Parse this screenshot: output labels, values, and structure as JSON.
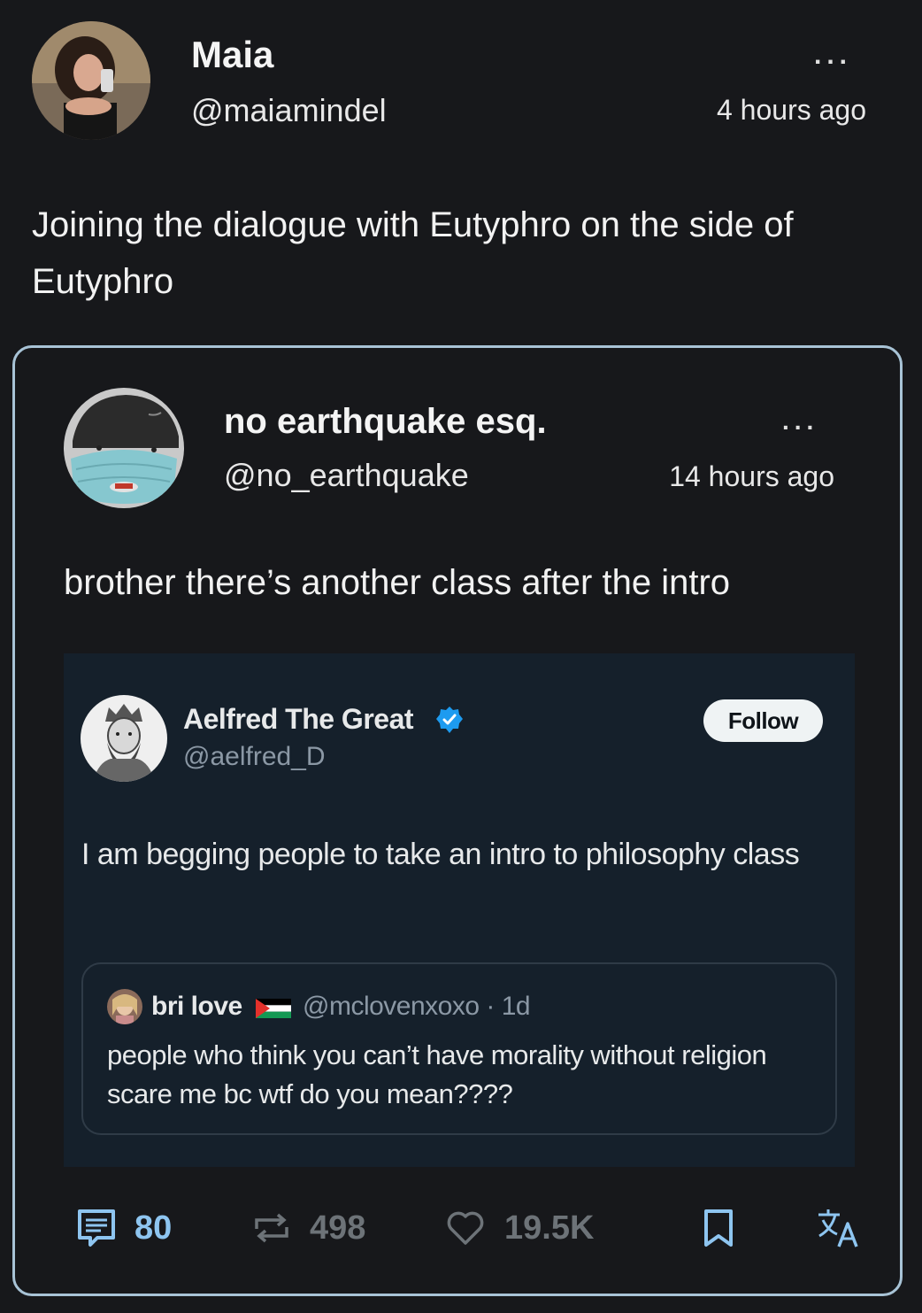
{
  "post": {
    "author_name": "Maia",
    "author_handle": "@maiamindel",
    "timestamp": "4 hours ago",
    "more_label": "...",
    "text": "Joining the dialogue with Eutyphro on the side of Eutyphro"
  },
  "quoted_post": {
    "author_name": "no earthquake esq.",
    "author_handle": "@no_earthquake",
    "timestamp": "14 hours ago",
    "more_label": "...",
    "text": "brother there’s another class after the intro",
    "embedded_tweet": {
      "author_name": "Aelfred The Great",
      "author_handle": "@aelfred_D",
      "verified": true,
      "follow_label": "Follow",
      "text": "I am begging people to take an intro to philosophy class",
      "quoted": {
        "author_name": "bri love",
        "handle_time": "@mclovenxoxo · 1d",
        "text": "people who think you can’t have morality without religion scare me bc wtf do you mean????"
      }
    }
  },
  "actions": {
    "comments": "80",
    "reposts": "498",
    "likes": "19.5K"
  },
  "colors": {
    "background": "#17181b",
    "quote_border": "#a8c3d6",
    "embedded_bg": "#15202b",
    "action_blue": "#8ec5f0",
    "action_gray": "#6d7378",
    "verified_blue": "#1d9bf0"
  },
  "icons": [
    "avatar-maia",
    "more-icon",
    "avatar-no-earthquake",
    "avatar-aelfred",
    "verified-badge-icon",
    "avatar-bri",
    "flag-icon",
    "comment-icon",
    "repost-icon",
    "heart-icon",
    "bookmark-icon",
    "translate-icon"
  ]
}
